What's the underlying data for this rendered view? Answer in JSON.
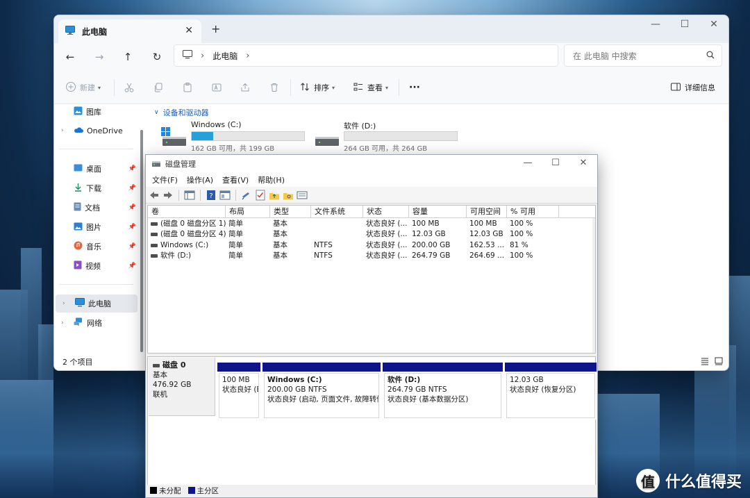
{
  "explorer": {
    "tab_title": "此电脑",
    "new_tab_glyph": "+",
    "close_glyph": "✕",
    "window_controls": {
      "minimize": "—",
      "maximize": "☐",
      "close": "✕"
    },
    "nav": {
      "back": "←",
      "forward": "→",
      "up": "↑",
      "refresh": "↻"
    },
    "address": {
      "root_sep": "›",
      "location": "此电脑",
      "trail_sep": "›"
    },
    "search_placeholder": "在 此电脑 中搜索",
    "toolbar": {
      "new_label": "新建",
      "sort_label": "排序",
      "view_label": "查看",
      "more_label": "···",
      "details_label": "详细信息"
    },
    "sidebar": {
      "top_item": "图库",
      "onedrive": "OneDrive",
      "pinned": [
        {
          "label": "桌面",
          "icon": "desktop-icon"
        },
        {
          "label": "下载",
          "icon": "download-icon"
        },
        {
          "label": "文档",
          "icon": "document-icon"
        },
        {
          "label": "图片",
          "icon": "pictures-icon"
        },
        {
          "label": "音乐",
          "icon": "music-icon"
        },
        {
          "label": "视频",
          "icon": "video-icon"
        }
      ],
      "this_pc": "此电脑",
      "network": "网络"
    },
    "group_header": "设备和驱动器",
    "drives": [
      {
        "name": "Windows (C:)",
        "info": "162 GB 可用，共 199 GB",
        "used_fraction": 0.19
      },
      {
        "name": "软件 (D:)",
        "info": "264 GB 可用，共 264 GB",
        "used_fraction": 0.0
      }
    ],
    "status_count": "2 个项目",
    "colors": {
      "accent": "#26a0da",
      "link": "#1e5fb3"
    }
  },
  "diskmgmt": {
    "title": "磁盘管理",
    "window_controls": {
      "minimize": "—",
      "maximize": "☐",
      "close": "✕"
    },
    "menu": [
      "文件(F)",
      "操作(A)",
      "查看(V)",
      "帮助(H)"
    ],
    "columns": [
      "卷",
      "布局",
      "类型",
      "文件系统",
      "状态",
      "容量",
      "可用空间",
      "% 可用"
    ],
    "rows": [
      [
        "(磁盘 0 磁盘分区 1)",
        "简单",
        "基本",
        "",
        "状态良好 (...",
        "100 MB",
        "100 MB",
        "100 %"
      ],
      [
        "(磁盘 0 磁盘分区 4)",
        "简单",
        "基本",
        "",
        "状态良好 (...",
        "12.03 GB",
        "12.03 GB",
        "100 %"
      ],
      [
        "Windows (C:)",
        "简单",
        "基本",
        "NTFS",
        "状态良好 (...",
        "200.00 GB",
        "162.53 ...",
        "81 %"
      ],
      [
        "软件 (D:)",
        "简单",
        "基本",
        "NTFS",
        "状态良好 (...",
        "264.79 GB",
        "264.69 ...",
        "100 %"
      ]
    ],
    "disk": {
      "name": "磁盘 0",
      "type": "基本",
      "size": "476.92 GB",
      "status": "联机"
    },
    "partitions": [
      {
        "name": "",
        "size": "100 MB",
        "status": "状态良好 (E"
      },
      {
        "name": "Windows  (C:)",
        "size": "200.00 GB NTFS",
        "status": "状态良好 (启动, 页面文件, 故障转储"
      },
      {
        "name": "软件  (D:)",
        "size": "264.79 GB NTFS",
        "status": "状态良好 (基本数据分区)"
      },
      {
        "name": "",
        "size": "12.03 GB",
        "status": "状态良好 (恢复分区)"
      }
    ],
    "legend": [
      {
        "label": "未分配",
        "color": "#000000"
      },
      {
        "label": "主分区",
        "color": "#10148b"
      }
    ]
  },
  "watermark": {
    "logo": "值",
    "text": "什么值得买"
  }
}
